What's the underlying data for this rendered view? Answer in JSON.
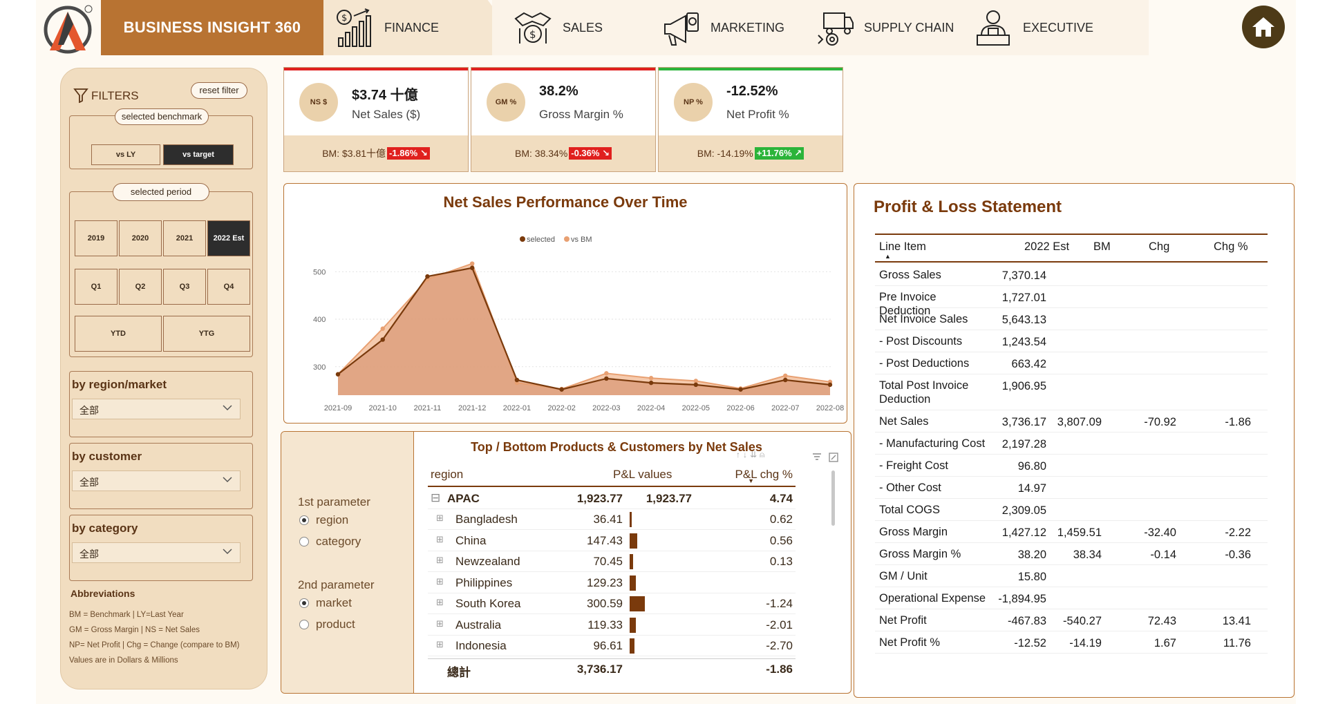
{
  "brand": {
    "title": "BUSINESS INSIGHT 360"
  },
  "nav": {
    "tabs": [
      {
        "label": "FINANCE",
        "icon": "finance-chart-icon"
      },
      {
        "label": "SALES",
        "icon": "handshake-dollar-icon"
      },
      {
        "label": "MARKETING",
        "icon": "megaphone-icon"
      },
      {
        "label": "SUPPLY CHAIN",
        "icon": "delivery-truck-icon"
      },
      {
        "label": "EXECUTIVE",
        "icon": "executive-person-icon"
      }
    ],
    "home_icon": "home-icon"
  },
  "filters": {
    "title": "FILTERS",
    "reset_label": "reset filter",
    "benchmark_label": "selected benchmark",
    "benchmark_options": [
      "vs LY",
      "vs target"
    ],
    "benchmark_selected": "vs target",
    "period_label": "selected period",
    "years": [
      "2019",
      "2020",
      "2021",
      "2022 Est"
    ],
    "year_selected": "2022 Est",
    "quarters": [
      "Q1",
      "Q2",
      "Q3",
      "Q4"
    ],
    "ytd": "YTD",
    "ytg": "YTG",
    "region": {
      "label": "by region/market",
      "value": "全部"
    },
    "customer": {
      "label": "by customer",
      "value": "全部"
    },
    "category": {
      "label": "by category",
      "value": "全部"
    },
    "abbr_title": "Abbreviations",
    "abbr_lines": [
      "BM = Benchmark | LY=Last Year",
      "GM = Gross Margin | NS = Net Sales",
      "NP= Net Profit | Chg = Change (compare to BM)",
      "Values are in Dollars & Millions"
    ]
  },
  "kpis": [
    {
      "badge": "NS $",
      "value": "$3.74 十億",
      "label": "Net Sales ($)",
      "bm": "BM: $3.81十億",
      "chg": "-1.86%",
      "dir": "down",
      "accent": "#e0201e"
    },
    {
      "badge": "GM %",
      "value": "38.2%",
      "label": "Gross Margin %",
      "bm": "BM: 38.34%",
      "chg": "-0.36%",
      "dir": "down",
      "accent": "#e0201e"
    },
    {
      "badge": "NP %",
      "value": "-12.52%",
      "label": "Net Profit %",
      "bm": "BM: -14.19%",
      "chg": "+11.76%",
      "dir": "up",
      "accent": "#2bb43a"
    }
  ],
  "chart_data": {
    "type": "area",
    "title": "Net Sales Performance Over Time",
    "legend": [
      "selected",
      "vs BM"
    ],
    "legend_position": "top-center",
    "x": [
      "2021-09",
      "2021-10",
      "2021-11",
      "2021-12",
      "2022-01",
      "2022-02",
      "2022-03",
      "2022-04",
      "2022-05",
      "2022-06",
      "2022-07",
      "2022-08"
    ],
    "series": [
      {
        "name": "selected",
        "values": [
          284,
          357,
          490,
          508,
          272,
          252,
          275,
          266,
          262,
          252,
          272,
          262
        ],
        "color": "#7a3a0c"
      },
      {
        "name": "vs BM",
        "values": [
          284,
          380,
          484,
          517,
          266,
          253,
          286,
          276,
          270,
          254,
          281,
          268
        ],
        "color": "#e8a072"
      }
    ],
    "ylim": [
      240,
      560
    ],
    "yticks": [
      300,
      400,
      500
    ],
    "grid": true,
    "xlabel": "",
    "ylabel": ""
  },
  "topbottom": {
    "title": "Top / Bottom Products & Customers by Net Sales",
    "param1_label": "1st parameter",
    "param1_options": [
      "region",
      "category"
    ],
    "param1_selected": "region",
    "param2_label": "2nd parameter",
    "param2_options": [
      "market",
      "product"
    ],
    "param2_selected": "market",
    "columns": [
      "region",
      "P&L values",
      "P&L chg %"
    ],
    "group": {
      "name": "APAC",
      "value": "1,923.77",
      "value2": "1,923.77",
      "chg": "4.74"
    },
    "rows": [
      {
        "name": "Bangladesh",
        "value": "36.41",
        "bar": 36.41,
        "chg": "0.62"
      },
      {
        "name": "China",
        "value": "147.43",
        "bar": 147.43,
        "chg": "0.56"
      },
      {
        "name": "Newzealand",
        "value": "70.45",
        "bar": 70.45,
        "chg": "0.13"
      },
      {
        "name": "Philippines",
        "value": "129.23",
        "bar": 129.23,
        "chg": ""
      },
      {
        "name": "South Korea",
        "value": "300.59",
        "bar": 300.59,
        "chg": "-1.24"
      },
      {
        "name": "Australia",
        "value": "119.33",
        "bar": 119.33,
        "chg": "-2.01"
      },
      {
        "name": "Indonesia",
        "value": "96.61",
        "bar": 96.61,
        "chg": "-2.70"
      }
    ],
    "total": {
      "name": "總計",
      "value": "3,736.17",
      "chg": "-1.86"
    }
  },
  "pl": {
    "title": "Profit & Loss Statement",
    "columns": [
      "Line Item",
      "2022 Est",
      "BM",
      "Chg",
      "Chg %"
    ],
    "rows": [
      {
        "item": "Gross Sales",
        "est": "7,370.14",
        "bm": "",
        "chg": "",
        "chgp": ""
      },
      {
        "item": "Pre Invoice Deduction",
        "est": "1,727.01",
        "bm": "",
        "chg": "",
        "chgp": ""
      },
      {
        "item": "Net Invoice Sales",
        "est": "5,643.13",
        "bm": "",
        "chg": "",
        "chgp": ""
      },
      {
        "item": "- Post Discounts",
        "est": "1,243.54",
        "bm": "",
        "chg": "",
        "chgp": ""
      },
      {
        "item": "- Post Deductions",
        "est": "663.42",
        "bm": "",
        "chg": "",
        "chgp": ""
      },
      {
        "item": "Total Post Invoice Deduction",
        "est": "1,906.95",
        "bm": "",
        "chg": "",
        "chgp": ""
      },
      {
        "item": "Net Sales",
        "est": "3,736.17",
        "bm": "3,807.09",
        "chg": "-70.92",
        "chgp": "-1.86"
      },
      {
        "item": "- Manufacturing Cost",
        "est": "2,197.28",
        "bm": "",
        "chg": "",
        "chgp": ""
      },
      {
        "item": "- Freight Cost",
        "est": "96.80",
        "bm": "",
        "chg": "",
        "chgp": ""
      },
      {
        "item": "- Other Cost",
        "est": "14.97",
        "bm": "",
        "chg": "",
        "chgp": ""
      },
      {
        "item": "Total COGS",
        "est": "2,309.05",
        "bm": "",
        "chg": "",
        "chgp": ""
      },
      {
        "item": "Gross Margin",
        "est": "1,427.12",
        "bm": "1,459.51",
        "chg": "-32.40",
        "chgp": "-2.22"
      },
      {
        "item": "Gross Margin %",
        "est": "38.20",
        "bm": "38.34",
        "chg": "-0.14",
        "chgp": "-0.36"
      },
      {
        "item": "GM / Unit",
        "est": "15.80",
        "bm": "",
        "chg": "",
        "chgp": ""
      },
      {
        "item": "Operational Expense",
        "est": "-1,894.95",
        "bm": "",
        "chg": "",
        "chgp": ""
      },
      {
        "item": "Net Profit",
        "est": "-467.83",
        "bm": "-540.27",
        "chg": "72.43",
        "chgp": "13.41"
      },
      {
        "item": "Net Profit %",
        "est": "-12.52",
        "bm": "-14.19",
        "chg": "1.67",
        "chgp": "11.76"
      }
    ]
  }
}
